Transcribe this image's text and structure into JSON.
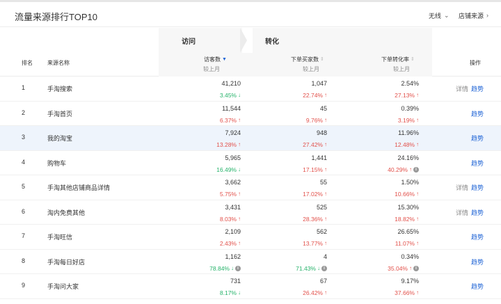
{
  "title": "流量来源排行TOP10",
  "device_select": "无线",
  "source_select": "店铺来源",
  "groups": {
    "visit": "访问",
    "conversion": "转化"
  },
  "columns": {
    "rank": "排名",
    "source": "来源名称",
    "visitors": "访客数",
    "buyers": "下单买家数",
    "rate": "下单转化率",
    "compare": "较上月",
    "ops": "操作"
  },
  "op_labels": {
    "detail": "详情",
    "trend": "趋势"
  },
  "rows": [
    {
      "rank": "1",
      "name": "手淘搜索",
      "visitors": "41,210",
      "visitors_chg": "3.45%",
      "visitors_dir": "down",
      "buyers": "1,047",
      "buyers_chg": "22.74%",
      "buyers_dir": "up",
      "rate": "2.54%",
      "rate_chg": "27.13%",
      "rate_dir": "up",
      "detail": true
    },
    {
      "rank": "2",
      "name": "手淘首页",
      "visitors": "11,544",
      "visitors_chg": "6.37%",
      "visitors_dir": "up",
      "buyers": "45",
      "buyers_chg": "9.76%",
      "buyers_dir": "up",
      "rate": "0.39%",
      "rate_chg": "3.19%",
      "rate_dir": "up",
      "detail": false
    },
    {
      "rank": "3",
      "name": "我的淘宝",
      "visitors": "7,924",
      "visitors_chg": "13.28%",
      "visitors_dir": "up",
      "buyers": "948",
      "buyers_chg": "27.42%",
      "buyers_dir": "up",
      "rate": "11.96%",
      "rate_chg": "12.48%",
      "rate_dir": "up",
      "detail": false,
      "highlight": true
    },
    {
      "rank": "4",
      "name": "购物车",
      "visitors": "5,965",
      "visitors_chg": "16.49%",
      "visitors_dir": "down",
      "buyers": "1,441",
      "buyers_chg": "17.15%",
      "buyers_dir": "up",
      "rate": "24.16%",
      "rate_chg": "40.29%",
      "rate_dir": "up",
      "rate_info": true,
      "detail": false
    },
    {
      "rank": "5",
      "name": "手淘其他店铺商品详情",
      "visitors": "3,662",
      "visitors_chg": "5.75%",
      "visitors_dir": "up",
      "buyers": "55",
      "buyers_chg": "17.02%",
      "buyers_dir": "up",
      "rate": "1.50%",
      "rate_chg": "10.66%",
      "rate_dir": "up",
      "detail": true
    },
    {
      "rank": "6",
      "name": "淘内免费其他",
      "visitors": "3,431",
      "visitors_chg": "8.03%",
      "visitors_dir": "up",
      "buyers": "525",
      "buyers_chg": "28.36%",
      "buyers_dir": "up",
      "rate": "15.30%",
      "rate_chg": "18.82%",
      "rate_dir": "up",
      "detail": true
    },
    {
      "rank": "7",
      "name": "手淘旺信",
      "visitors": "2,109",
      "visitors_chg": "2.43%",
      "visitors_dir": "up",
      "buyers": "562",
      "buyers_chg": "13.77%",
      "buyers_dir": "up",
      "rate": "26.65%",
      "rate_chg": "11.07%",
      "rate_dir": "up",
      "detail": false
    },
    {
      "rank": "8",
      "name": "手淘每日好店",
      "visitors": "1,162",
      "visitors_chg": "78.84%",
      "visitors_dir": "down",
      "visitors_info": true,
      "buyers": "4",
      "buyers_chg": "71.43%",
      "buyers_dir": "down",
      "buyers_info": true,
      "rate": "0.34%",
      "rate_chg": "35.04%",
      "rate_dir": "up",
      "rate_info": true,
      "detail": false
    },
    {
      "rank": "9",
      "name": "手淘问大家",
      "visitors": "731",
      "visitors_chg": "8.17%",
      "visitors_dir": "down",
      "buyers": "67",
      "buyers_chg": "26.42%",
      "buyers_dir": "up",
      "rate": "9.17%",
      "rate_chg": "37.66%",
      "rate_dir": "up",
      "detail": false
    }
  ]
}
